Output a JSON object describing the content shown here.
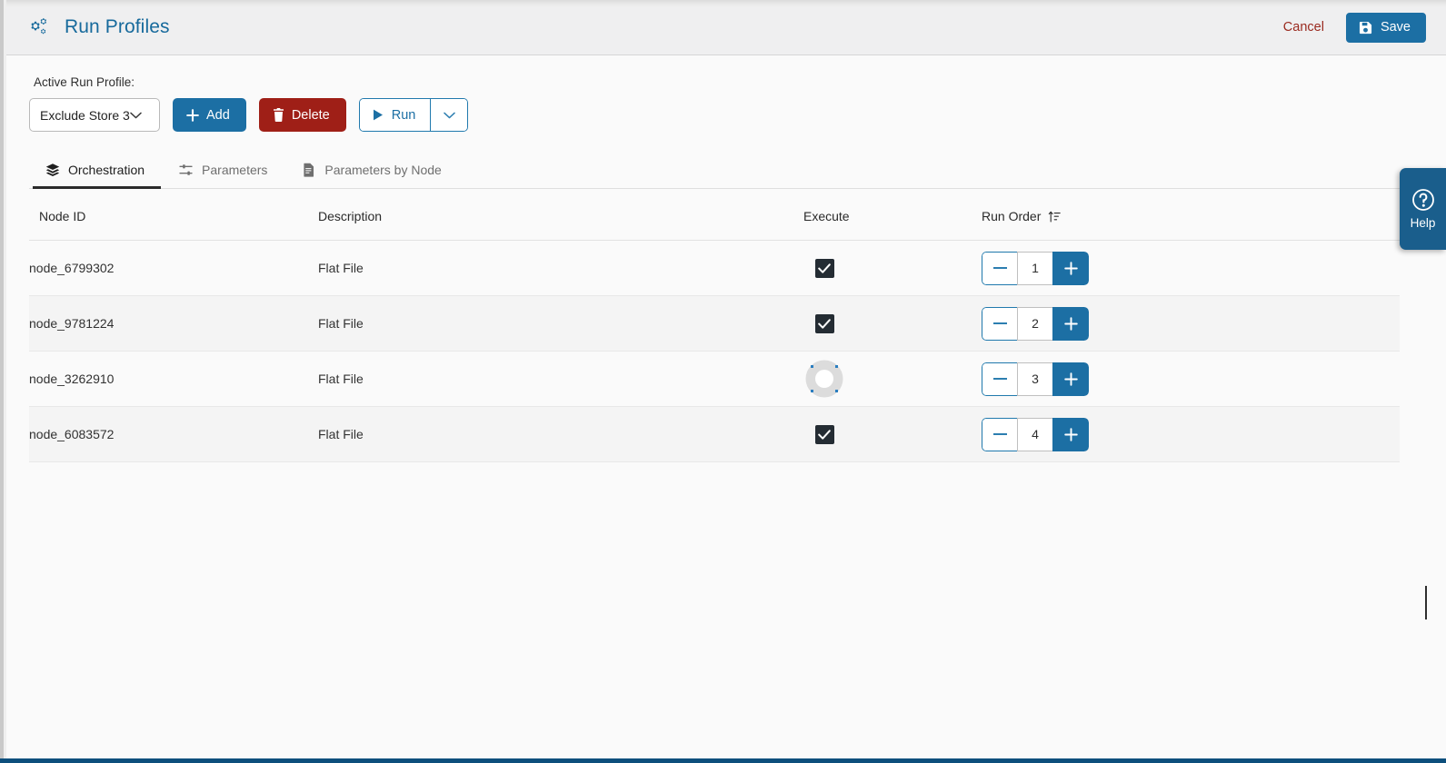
{
  "header": {
    "title": "Run Profiles",
    "icon": "gears-icon",
    "title_color": "#176a9c",
    "cancel_label": "Cancel",
    "save_label": "Save",
    "save_icon": "floppy-disk-icon",
    "save_color": "#1c6fa4",
    "cancel_color": "#9a2a1f"
  },
  "toolbar": {
    "active_profile_label": "Active Run Profile:",
    "profile_select": {
      "value": "Exclude Store 3",
      "icon": "chevron-down-icon"
    },
    "add_label": "Add",
    "add_icon": "plus-icon",
    "add_color": "#1c6fa4",
    "delete_label": "Delete",
    "delete_icon": "trash-icon",
    "delete_color": "#9f1f17",
    "run_label": "Run",
    "run_icon": "play-icon",
    "run_caret_icon": "chevron-down-icon",
    "run_color": "#1c6fa4"
  },
  "tabs": [
    {
      "label": "Orchestration",
      "icon": "layers-icon",
      "active": true
    },
    {
      "label": "Parameters",
      "icon": "sliders-icon",
      "active": false
    },
    {
      "label": "Parameters by Node",
      "icon": "document-icon",
      "active": false
    }
  ],
  "table": {
    "columns": [
      "Node ID",
      "Description",
      "Execute",
      "Run Order"
    ],
    "sort": {
      "column": "Run Order",
      "icon": "sort-ascending-icon",
      "direction": "ascending"
    },
    "rows": [
      {
        "node_id": "node_6799302",
        "description": "Flat File",
        "execute": true,
        "run_order": "1",
        "checkbox_state": "checked"
      },
      {
        "node_id": "node_9781224",
        "description": "Flat File",
        "execute": true,
        "run_order": "2",
        "checkbox_state": "checked"
      },
      {
        "node_id": "node_3262910",
        "description": "Flat File",
        "execute": false,
        "run_order": "3",
        "checkbox_state": "unchecked-focused"
      },
      {
        "node_id": "node_6083572",
        "description": "Flat File",
        "execute": true,
        "run_order": "4",
        "checkbox_state": "checked"
      }
    ],
    "stepper": {
      "decrement_icon": "minus-icon",
      "increment_icon": "plus-icon"
    }
  },
  "help": {
    "label": "Help",
    "icon": "question-circle-icon",
    "color": "#1a5e8c"
  },
  "footer": {
    "accent_color": "#0d4f7c"
  }
}
